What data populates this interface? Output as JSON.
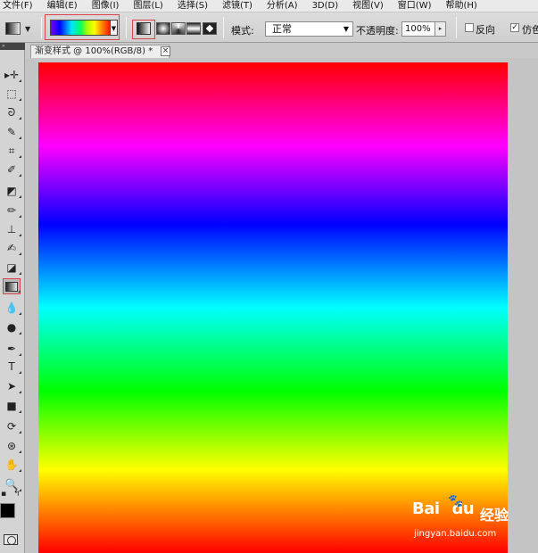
{
  "menu": [
    "文件(F)",
    "编辑(E)",
    "图像(I)",
    "图层(L)",
    "选择(S)",
    "滤镜(T)",
    "分析(A)",
    "3D(D)",
    "视图(V)",
    "窗口(W)",
    "帮助(H)"
  ],
  "options_bar": {
    "mode_label": "模式:",
    "mode_value": "正常",
    "opacity_label": "不透明度:",
    "opacity_value": "100%",
    "reverse_label": "反向",
    "reverse_checked": false,
    "dither_label": "仿色",
    "dither_checked": true,
    "check_mark": "✓"
  },
  "toolbox": {
    "tools": [
      {
        "name": "move-tool",
        "icon": "move-icon",
        "glyph": "▸✛"
      },
      {
        "name": "marquee-tool",
        "icon": "rect-marquee-icon",
        "glyph": "⬚"
      },
      {
        "name": "lasso-tool",
        "icon": "lasso-icon",
        "glyph": "ᘐ"
      },
      {
        "name": "quick-select-tool",
        "icon": "quick-select-icon",
        "glyph": "✎"
      },
      {
        "name": "crop-tool",
        "icon": "crop-icon",
        "glyph": "⌗"
      },
      {
        "name": "eyedropper-tool",
        "icon": "eyedropper-icon",
        "glyph": "✐"
      },
      {
        "name": "healing-brush-tool",
        "icon": "bandage-icon",
        "glyph": "◩"
      },
      {
        "name": "brush-tool",
        "icon": "brush-icon",
        "glyph": "✏"
      },
      {
        "name": "clone-stamp-tool",
        "icon": "stamp-icon",
        "glyph": "⊥"
      },
      {
        "name": "history-brush-tool",
        "icon": "history-brush-icon",
        "glyph": "✍"
      },
      {
        "name": "eraser-tool",
        "icon": "eraser-icon",
        "glyph": "◪"
      },
      {
        "name": "gradient-tool",
        "icon": "gradient-icon",
        "glyph": ""
      },
      {
        "name": "blur-tool",
        "icon": "drop-icon",
        "glyph": "💧"
      },
      {
        "name": "dodge-tool",
        "icon": "dodge-icon",
        "glyph": "●"
      },
      {
        "name": "pen-tool",
        "icon": "pen-icon",
        "glyph": "✒"
      },
      {
        "name": "type-tool",
        "icon": "type-icon",
        "glyph": "T"
      },
      {
        "name": "path-select-tool",
        "icon": "arrow-icon",
        "glyph": "➤"
      },
      {
        "name": "shape-tool",
        "icon": "rectangle-shape-icon",
        "glyph": "■"
      },
      {
        "name": "3d-rotate-tool",
        "icon": "3d-rotate-icon",
        "glyph": "⟳"
      },
      {
        "name": "3d-orbit-tool",
        "icon": "3d-orbit-icon",
        "glyph": "⊛"
      },
      {
        "name": "hand-tool",
        "icon": "hand-icon",
        "glyph": "✋"
      },
      {
        "name": "zoom-tool",
        "icon": "zoom-icon",
        "glyph": "🔍"
      }
    ],
    "default_colors": "▪",
    "swap_colors": "↰"
  },
  "document": {
    "tab_title": "渐变样式 @ 100%(RGB/8) *",
    "close_glyph": "×"
  },
  "watermark": {
    "logo": "Bai",
    "logo2": "du",
    "paw": "🐾",
    "brand": "经验",
    "url": "jingyan.baidu.com"
  }
}
